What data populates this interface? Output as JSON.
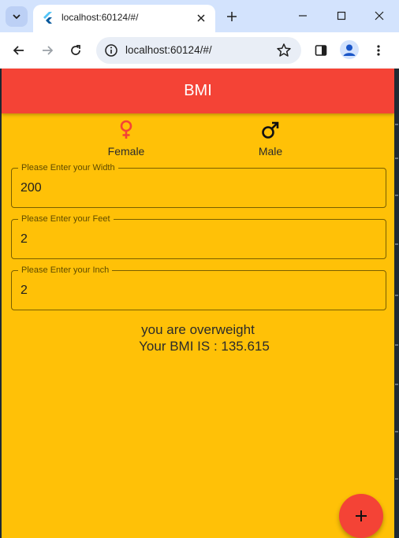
{
  "browser": {
    "tab_title": "localhost:60124/#/",
    "url": "localhost:60124/#/",
    "colors": {
      "tabstrip": "#d3e3fd",
      "toolbar": "#ffffff",
      "omnibox": "#e9eef6"
    }
  },
  "app": {
    "title": "BMI",
    "colors": {
      "appbar": "#f44336",
      "background": "#ffc107",
      "fab": "#f44336",
      "female_icon": "#f44336",
      "male_icon": "#111111"
    },
    "gender": {
      "female": {
        "icon": "female-icon",
        "label": "Female"
      },
      "male": {
        "icon": "male-icon",
        "label": "Male"
      }
    },
    "fields": {
      "width": {
        "label": "Please Enter your Width",
        "value": "200"
      },
      "feet": {
        "label": "Please Enter your Feet",
        "value": "2"
      },
      "inch": {
        "label": "Please Enter your Inch",
        "value": "2"
      }
    },
    "result": {
      "status": "you are overweight",
      "bmi_line": "Your BMI IS : 135.615"
    },
    "fab_icon": "plus-icon"
  }
}
